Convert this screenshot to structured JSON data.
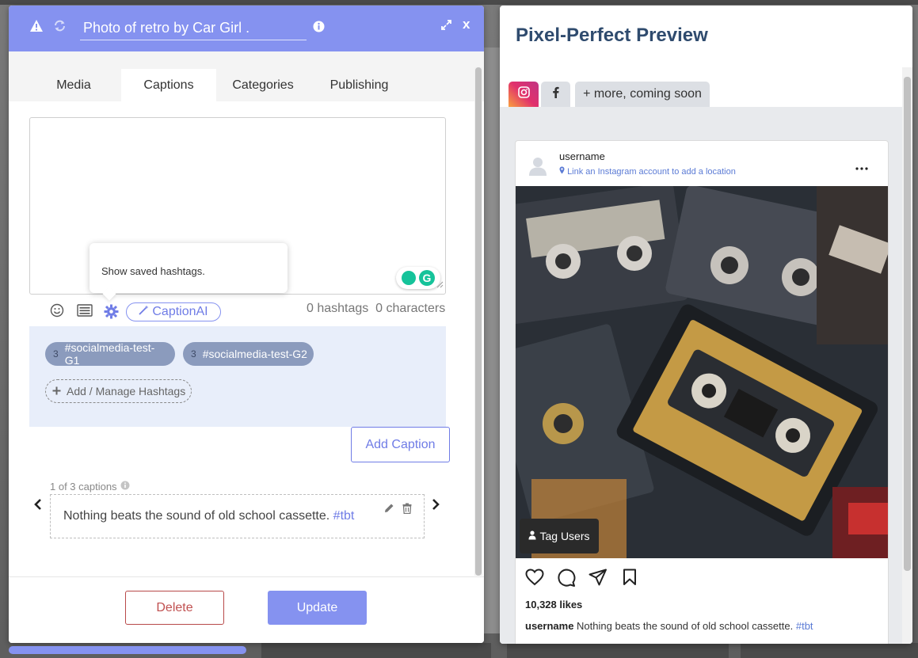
{
  "modal": {
    "title_value": "Photo of retro by Car Girl .",
    "tabs": [
      {
        "label": "Media"
      },
      {
        "label": "Captions"
      },
      {
        "label": "Categories"
      },
      {
        "label": "Publishing"
      }
    ],
    "active_tab": "Captions",
    "caption_text": "",
    "tooltip": "Show saved hashtags.",
    "caption_ai_label": "CaptionAI",
    "hashtag_count_label": "0 hashtags",
    "character_count_label": "0 characters",
    "hashtag_groups": [
      {
        "count": "3",
        "label": "#socialmedia-test-G1"
      },
      {
        "count": "3",
        "label": "#socialmedia-test-G2"
      }
    ],
    "add_hashtag_label": "Add / Manage Hashtags",
    "add_caption_label": "Add Caption",
    "caption_index_label": "1 of 3 captions",
    "saved_caption": {
      "text": "Nothing beats the sound of old school cassette.",
      "hashtag": "#tbt"
    },
    "delete_label": "Delete",
    "update_label": "Update"
  },
  "preview": {
    "title": "Pixel-Perfect Preview",
    "tabs": {
      "more_label": "+ more, coming soon"
    },
    "post": {
      "username": "username",
      "location_hint": "Link an Instagram account to add a location",
      "tag_users_label": "Tag Users",
      "likes": "10,328 likes",
      "caption_username": "username",
      "caption_text": "Nothing beats the sound of old school cassette.",
      "caption_hashtag": "#tbt"
    }
  },
  "colors": {
    "accent": "#8592f0",
    "preview_title": "#2f4b6e",
    "hashtag_link": "#6f7ce6",
    "delete_red": "#c05050",
    "hashtag_panel_bg": "#e8eefa"
  },
  "icons": [
    "warning-icon",
    "sync-icon",
    "info-icon",
    "expand-icon",
    "close-icon",
    "emoji-icon",
    "template-list-icon",
    "settings-gear-icon",
    "magic-wand-icon",
    "plus-icon",
    "chevron-left-icon",
    "chevron-right-icon",
    "pencil-icon",
    "trash-icon",
    "instagram-icon",
    "facebook-icon",
    "avatar-icon",
    "more-dots-icon",
    "user-icon",
    "heart-icon",
    "comment-icon",
    "share-icon",
    "bookmark-icon"
  ]
}
